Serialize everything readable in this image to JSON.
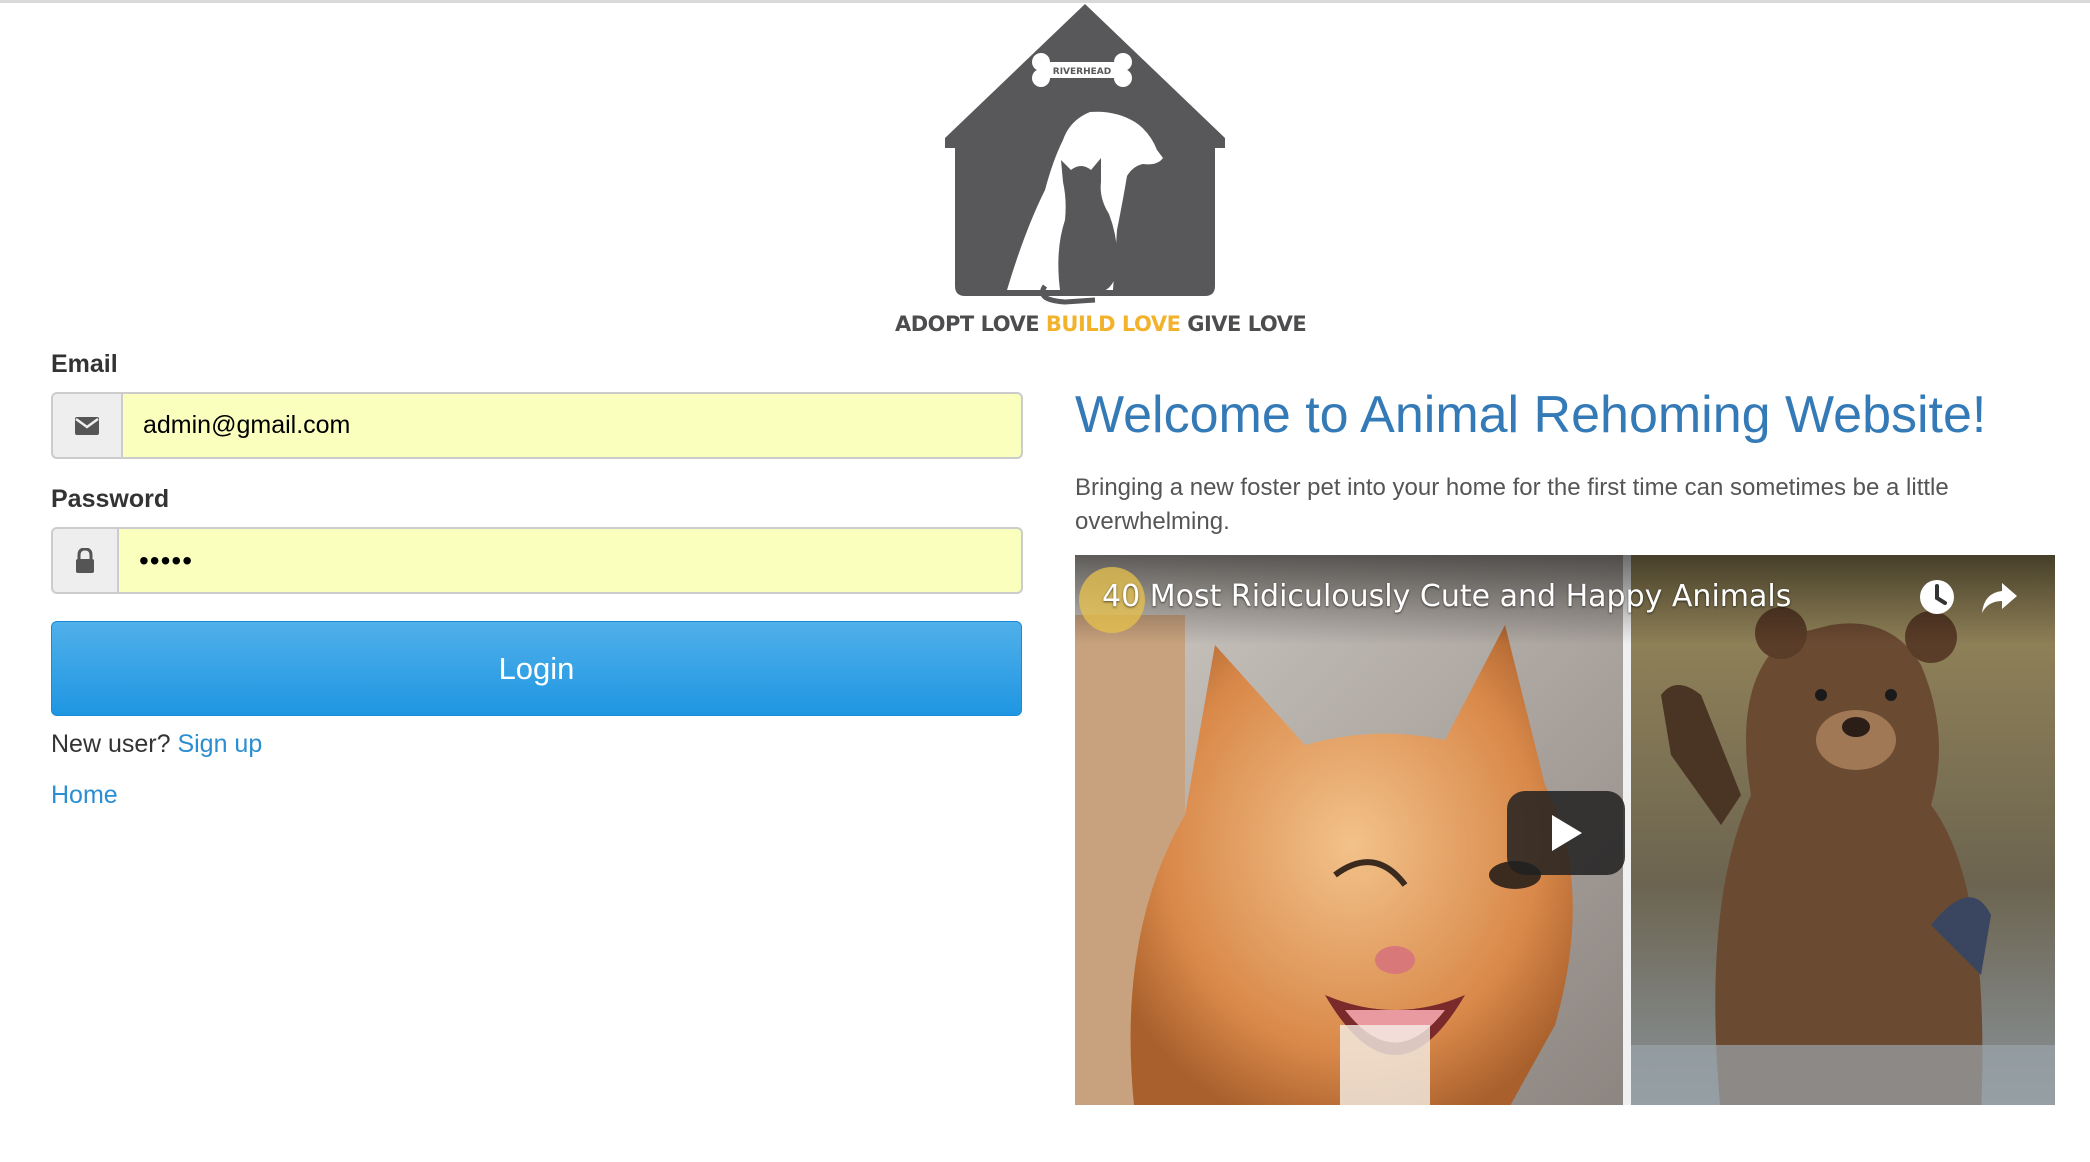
{
  "logo": {
    "badge_text": "RIVERHEAD",
    "tagline": {
      "part1": "ADOPT LOVE ",
      "part2": "BUILD LOVE",
      "part3": " GIVE LOVE"
    },
    "colors": {
      "house": "#58585a",
      "highlight": "#f2b22c"
    }
  },
  "form": {
    "email_label": "Email",
    "email_value": "admin@gmail.com",
    "email_icon": "envelope-icon",
    "password_label": "Password",
    "password_value": "•••••",
    "password_icon": "lock-icon",
    "login_label": "Login",
    "new_user_text": "New user?",
    "signup_link": "Sign up",
    "home_link": "Home"
  },
  "welcome": {
    "heading": "Welcome to Animal Rehoming Website!",
    "body": "Bringing a new foster pet into your home for the first time can sometimes be a little overwhelming."
  },
  "video": {
    "title": "40 Most Ridiculously Cute and Happy Animals",
    "icons": [
      "watch-later-icon",
      "share-icon",
      "play-icon"
    ]
  },
  "colors": {
    "accent": "#337ab7",
    "link": "#2a8ed2",
    "button": "#1f96e2",
    "autofill": "#faffbd"
  }
}
